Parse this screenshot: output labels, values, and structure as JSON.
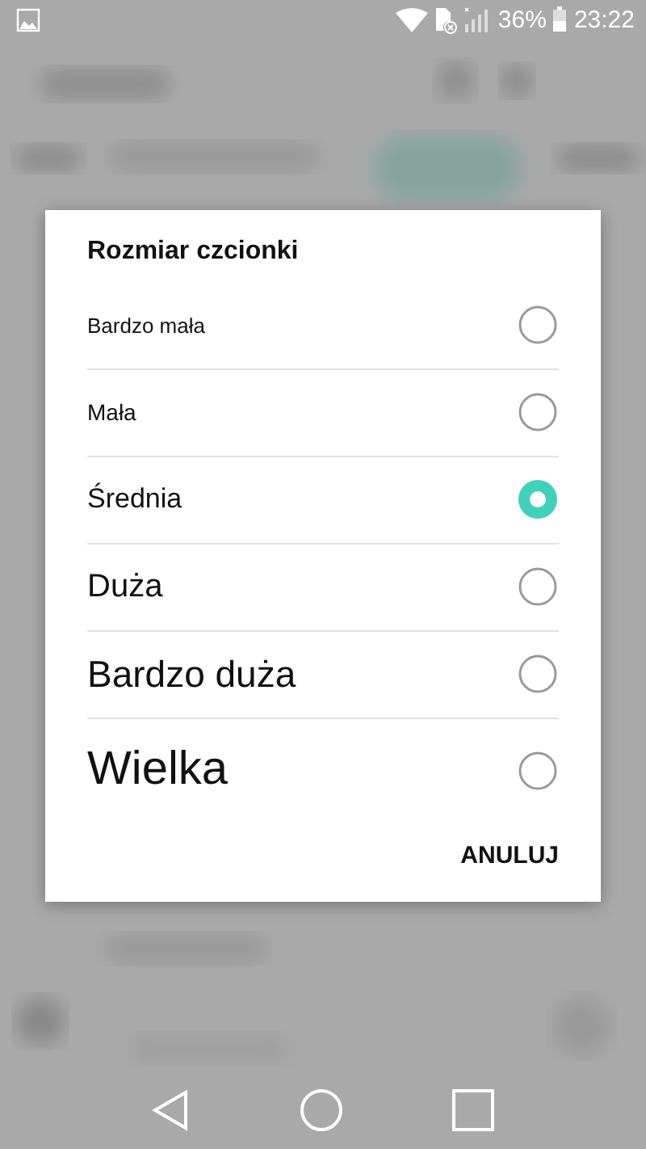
{
  "status_bar": {
    "battery": "36%",
    "time": "23:22"
  },
  "dialog": {
    "title": "Rozmiar czcionki",
    "options": [
      {
        "label": "Bardzo mała",
        "selected": false
      },
      {
        "label": "Mała",
        "selected": false
      },
      {
        "label": "Średnia",
        "selected": true
      },
      {
        "label": "Duża",
        "selected": false
      },
      {
        "label": "Bardzo duża",
        "selected": false
      },
      {
        "label": "Wielka",
        "selected": false
      }
    ],
    "buttons": [
      "ANULUJ"
    ]
  }
}
